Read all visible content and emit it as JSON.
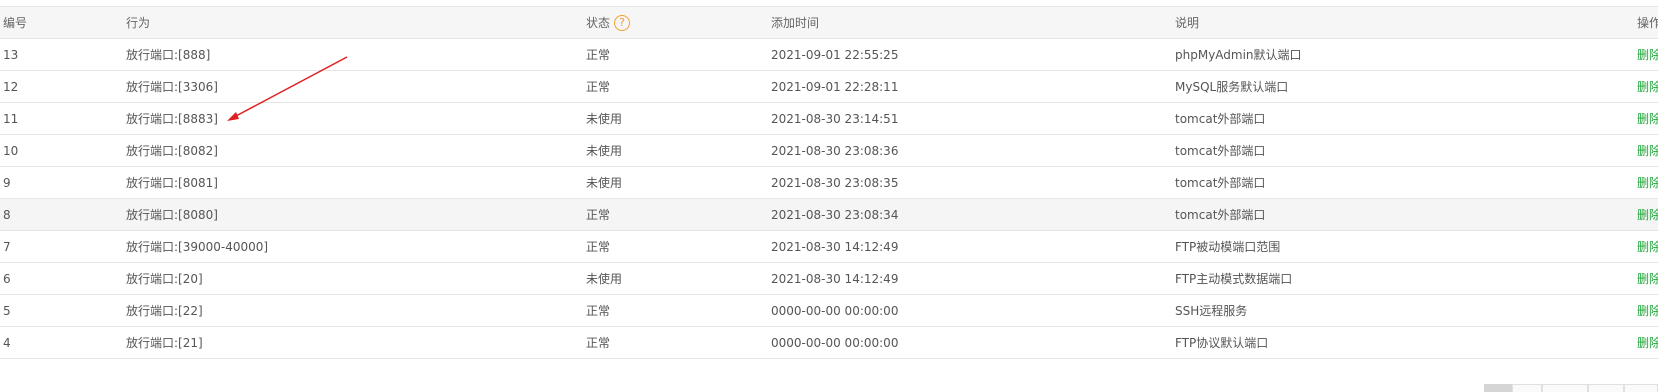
{
  "table": {
    "headers": {
      "id": "编号",
      "action": "行为",
      "status": "状态",
      "time": "添加时间",
      "desc": "说明",
      "op": "操作"
    },
    "help_icon": "question-circle-icon",
    "rows": [
      {
        "id": "13",
        "action": "放行端口:[888]",
        "status": "正常",
        "time": "2021-09-01 22:55:25",
        "desc": "phpMyAdmin默认端口",
        "op": "删除"
      },
      {
        "id": "12",
        "action": "放行端口:[3306]",
        "status": "正常",
        "time": "2021-09-01 22:28:11",
        "desc": "MySQL服务默认端口",
        "op": "删除"
      },
      {
        "id": "11",
        "action": "放行端口:[8883]",
        "status": "未使用",
        "time": "2021-08-30 23:14:51",
        "desc": "tomcat外部端口",
        "op": "删除"
      },
      {
        "id": "10",
        "action": "放行端口:[8082]",
        "status": "未使用",
        "time": "2021-08-30 23:08:36",
        "desc": "tomcat外部端口",
        "op": "删除"
      },
      {
        "id": "9",
        "action": "放行端口:[8081]",
        "status": "未使用",
        "time": "2021-08-30 23:08:35",
        "desc": "tomcat外部端口",
        "op": "删除"
      },
      {
        "id": "8",
        "action": "放行端口:[8080]",
        "status": "正常",
        "time": "2021-08-30 23:08:34",
        "desc": "tomcat外部端口",
        "op": "删除"
      },
      {
        "id": "7",
        "action": "放行端口:[39000-40000]",
        "status": "正常",
        "time": "2021-08-30 14:12:49",
        "desc": "FTP被动模端口范围",
        "op": "删除"
      },
      {
        "id": "6",
        "action": "放行端口:[20]",
        "status": "未使用",
        "time": "2021-08-30 14:12:49",
        "desc": "FTP主动模式数据端口",
        "op": "删除"
      },
      {
        "id": "5",
        "action": "放行端口:[22]",
        "status": "正常",
        "time": "0000-00-00 00:00:00",
        "desc": "SSH远程服务",
        "op": "删除"
      },
      {
        "id": "4",
        "action": "放行端口:[21]",
        "status": "正常",
        "time": "0000-00-00 00:00:00",
        "desc": "FTP协议默认端口",
        "op": "删除"
      }
    ]
  },
  "colors": {
    "link": "#20a53a",
    "help": "#f0a030",
    "annotation_arrow": "#e02020"
  }
}
